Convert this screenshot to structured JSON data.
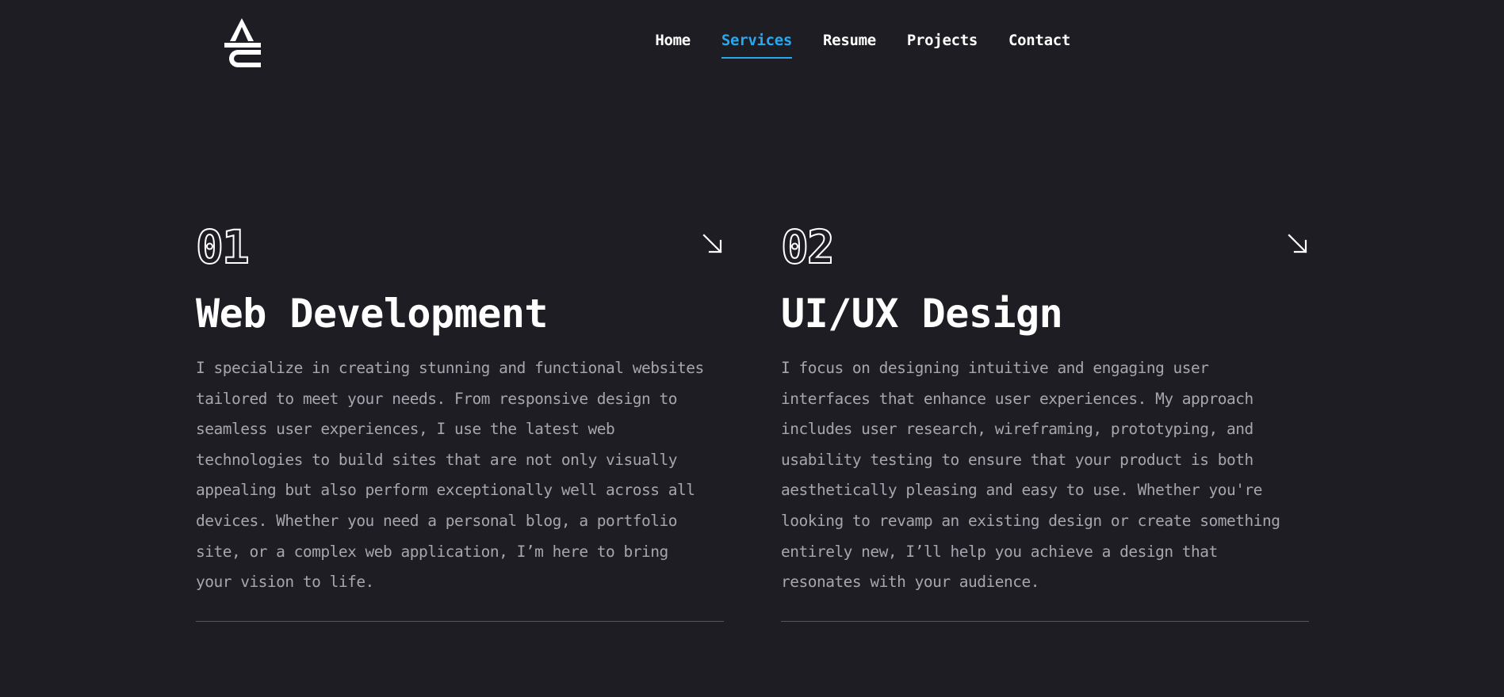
{
  "nav": {
    "items": [
      {
        "label": "Home",
        "active": false
      },
      {
        "label": "Services",
        "active": true
      },
      {
        "label": "Resume",
        "active": false
      },
      {
        "label": "Projects",
        "active": false
      },
      {
        "label": "Contact",
        "active": false
      }
    ]
  },
  "colors": {
    "background": "#1d1d23",
    "accent": "#27a9f0",
    "text": "#ffffff",
    "muted_text": "#a6a6ad"
  },
  "services": [
    {
      "number": "01",
      "title": "Web Development",
      "arrow_icon": "arrow-down-right-icon",
      "description": "I specialize in creating stunning and functional websites\ntailored to meet your needs. From responsive design to\nseamless user experiences, I use the latest web\ntechnologies to build sites that are not only visually\nappealing but also perform exceptionally well across all\ndevices. Whether you need a personal blog, a portfolio\nsite, or a complex web application, I’m here to bring\nyour vision to life."
    },
    {
      "number": "02",
      "title": "UI/UX Design",
      "arrow_icon": "arrow-down-right-icon",
      "description": "I focus on designing intuitive and engaging user\ninterfaces that enhance user experiences. My approach\nincludes user research, wireframing, prototyping, and\nusability testing to ensure that your product is both\naesthetically pleasing and easy to use. Whether you're\nlooking to revamp an existing design or create something\nentirely new, I’ll help you achieve a design that\nresonates with your audience."
    }
  ]
}
